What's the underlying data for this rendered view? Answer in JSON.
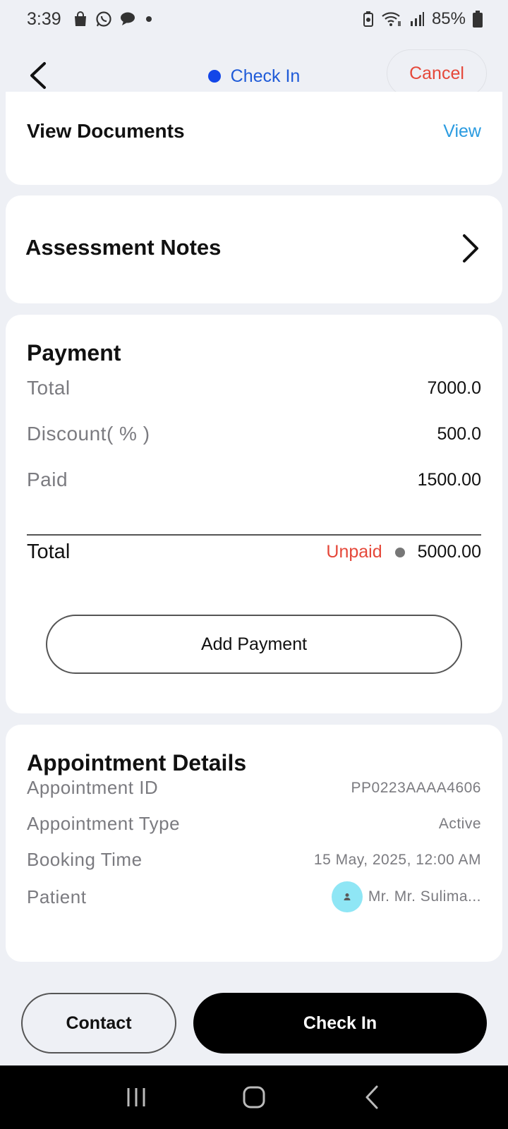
{
  "status_bar": {
    "time": "3:39",
    "battery": "85%"
  },
  "header": {
    "status_label": "Check In",
    "cancel_label": "Cancel"
  },
  "documents": {
    "title": "View Documents",
    "view_label": "View"
  },
  "assessment": {
    "title": "Assessment Notes"
  },
  "payment": {
    "title": "Payment",
    "rows": [
      {
        "label": "Total",
        "value": "7000.0"
      },
      {
        "label": "Discount( % )",
        "value": "500.0"
      },
      {
        "label": "Paid",
        "value": "1500.00"
      }
    ],
    "total_label": "Total",
    "status": "Unpaid",
    "balance": "5000.00",
    "add_payment_label": "Add Payment"
  },
  "appointment": {
    "title": "Appointment Details",
    "rows": [
      {
        "label": "Appointment ID",
        "value": "PP0223AAAA4606"
      },
      {
        "label": "Appointment Type",
        "value": "Active"
      },
      {
        "label": "Booking Time",
        "value": "15 May, 2025, 12:00 AM"
      }
    ],
    "patient_label": "Patient",
    "patient_name": "Mr. Mr. Sulima..."
  },
  "actions": {
    "contact_label": "Contact",
    "checkin_label": "Check In"
  },
  "colors": {
    "accent_blue": "#1f5bd8",
    "cancel_red": "#e5483a",
    "link_blue": "#2a9be0",
    "avatar_bg": "#8fe6f5"
  },
  "icons": [
    "shopping-bag-icon",
    "whatsapp-icon",
    "chat-icon",
    "battery-saver-icon",
    "wifi-icon",
    "signal-icon",
    "battery-icon",
    "back-arrow-icon",
    "chevron-right-icon",
    "person-icon",
    "recents-icon",
    "home-icon",
    "nav-back-icon"
  ]
}
